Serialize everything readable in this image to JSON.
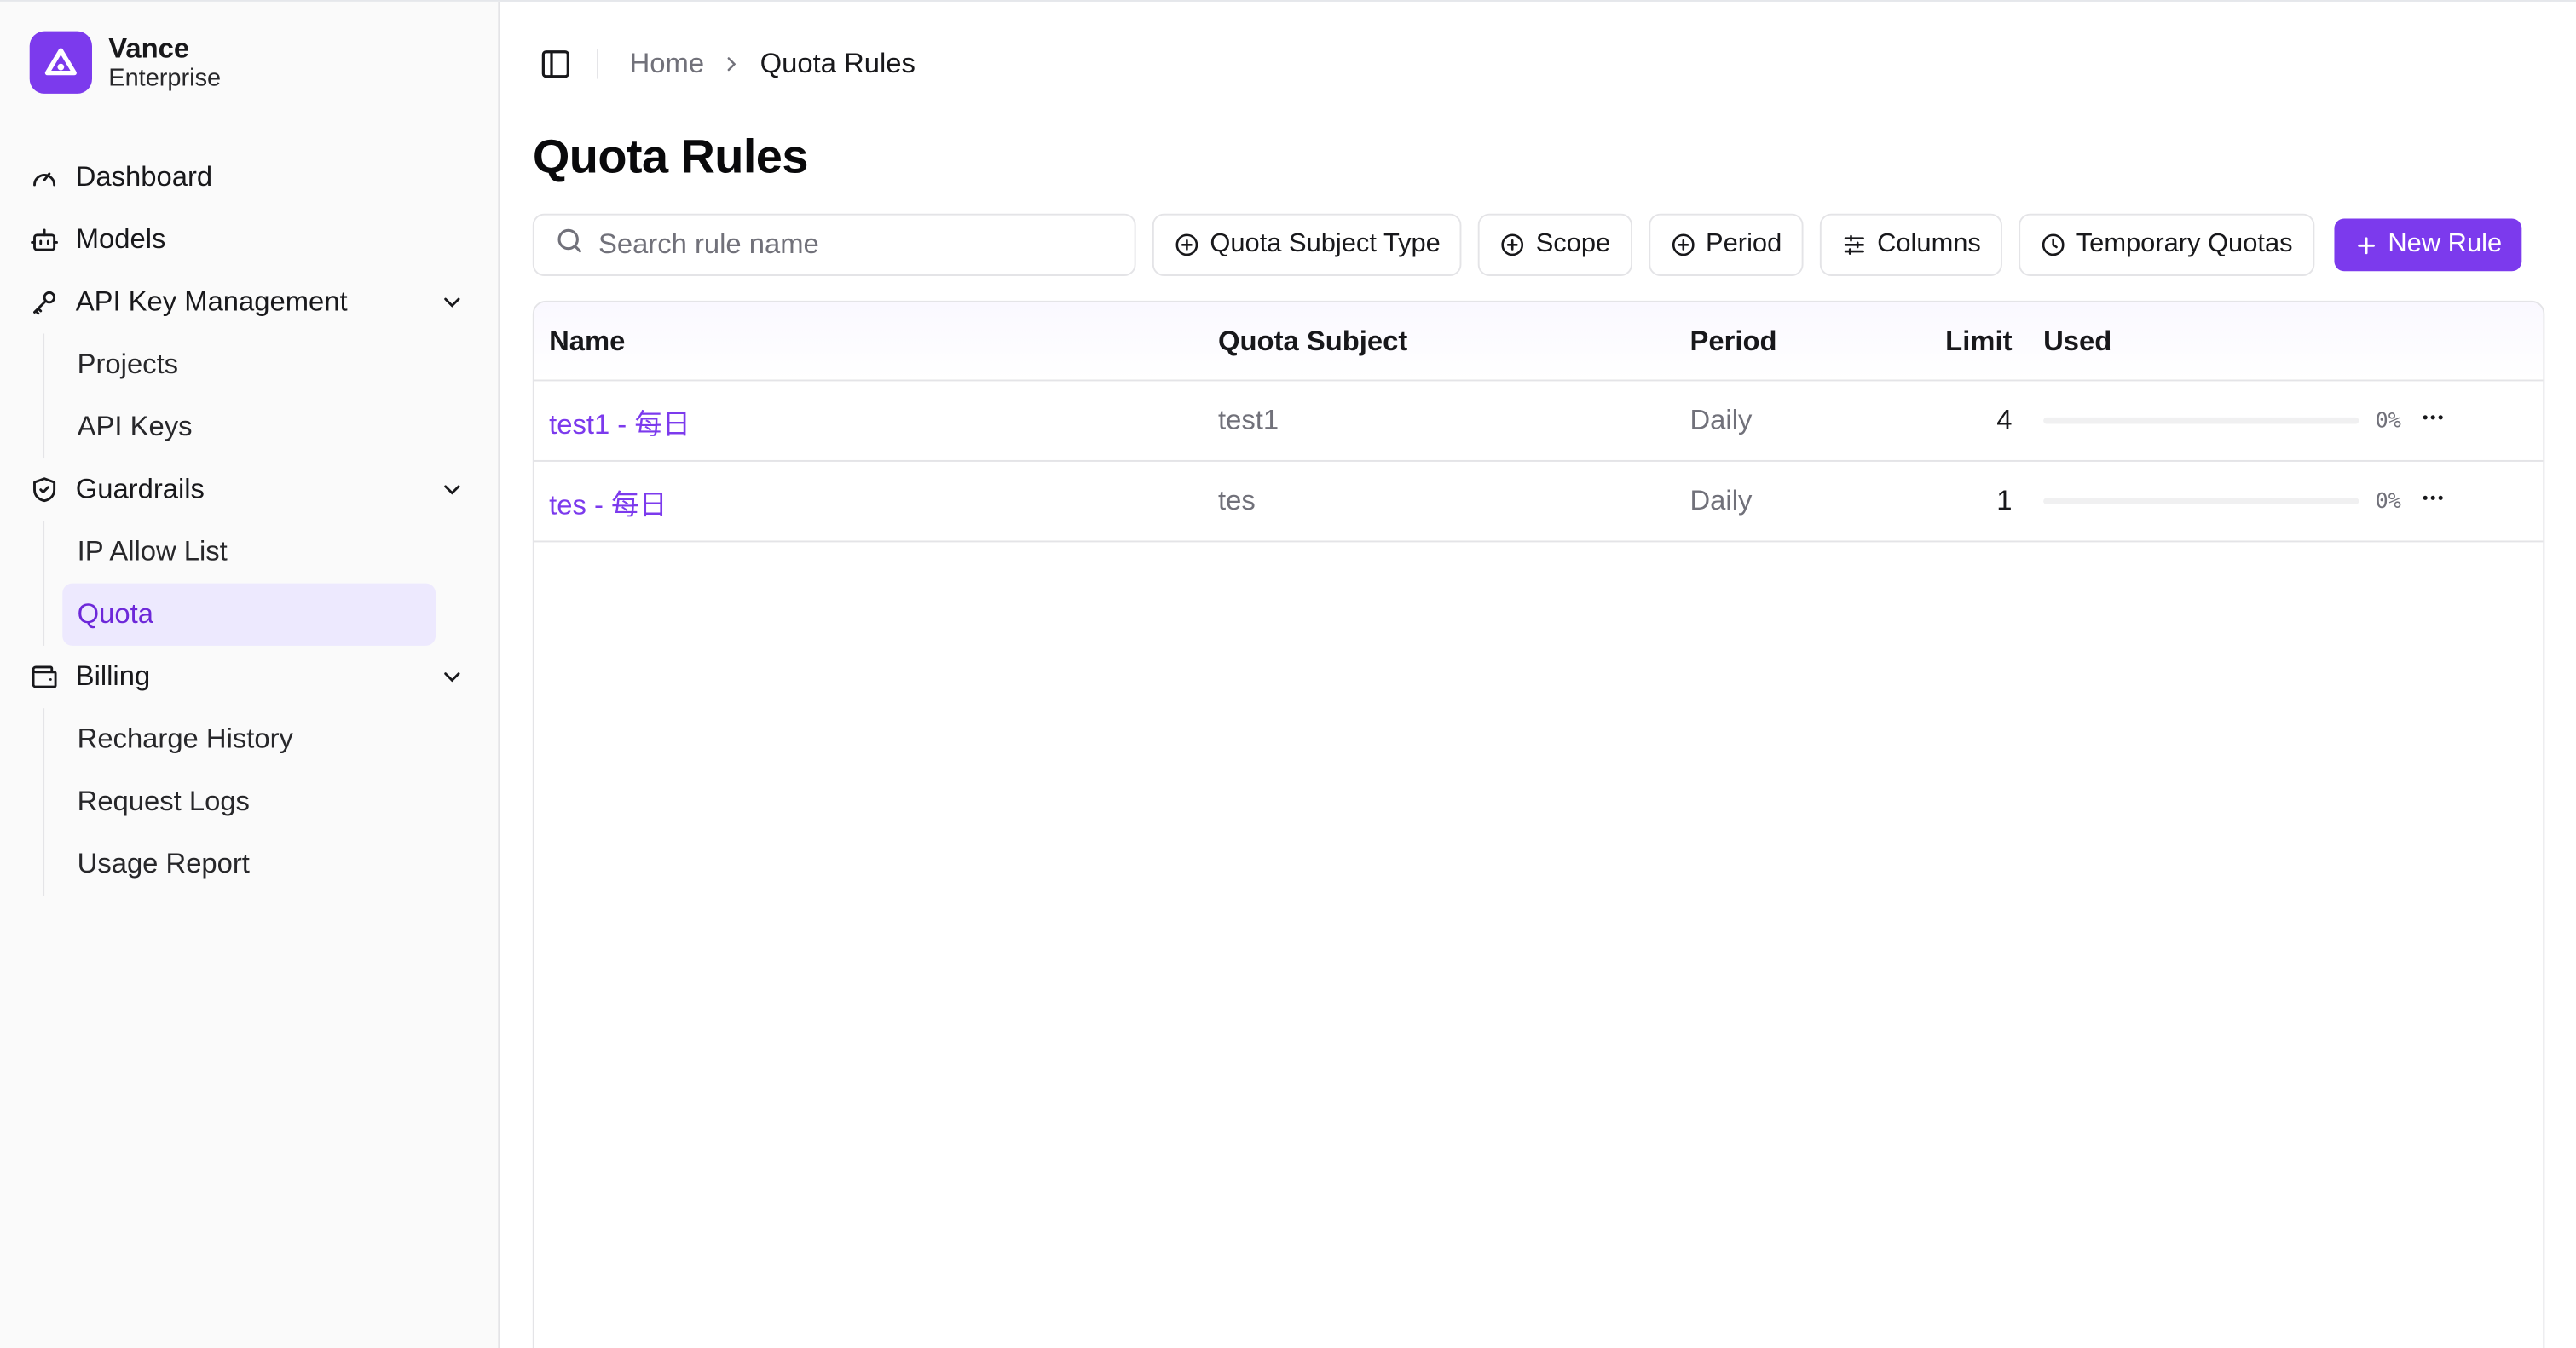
{
  "brand": {
    "name": "Vance",
    "subtitle": "Enterprise"
  },
  "sidebar": {
    "items": [
      {
        "label": "Dashboard",
        "icon": "gauge-icon"
      },
      {
        "label": "Models",
        "icon": "robot-icon"
      },
      {
        "label": "API Key Management",
        "icon": "key-icon",
        "expanded": true,
        "children": [
          {
            "label": "Projects"
          },
          {
            "label": "API Keys"
          }
        ]
      },
      {
        "label": "Guardrails",
        "icon": "shield-check-icon",
        "expanded": true,
        "children": [
          {
            "label": "IP Allow List"
          },
          {
            "label": "Quota",
            "active": true
          }
        ]
      },
      {
        "label": "Billing",
        "icon": "wallet-icon",
        "expanded": true,
        "children": [
          {
            "label": "Recharge History"
          },
          {
            "label": "Request Logs"
          },
          {
            "label": "Usage Report"
          }
        ]
      }
    ]
  },
  "breadcrumb": {
    "home": "Home",
    "current": "Quota Rules"
  },
  "page": {
    "title": "Quota Rules"
  },
  "toolbar": {
    "search_placeholder": "Search rule name",
    "filter_subject": "Quota Subject Type",
    "filter_scope": "Scope",
    "filter_period": "Period",
    "columns": "Columns",
    "temporary": "Temporary Quotas",
    "new_rule": "New Rule"
  },
  "table": {
    "headers": {
      "name": "Name",
      "subject": "Quota Subject",
      "period": "Period",
      "limit": "Limit",
      "used": "Used"
    },
    "rows": [
      {
        "name": "test1 - 每日",
        "subject": "test1",
        "period": "Daily",
        "limit": "4",
        "used_pct": "0%",
        "used_fraction": 0
      },
      {
        "name": "tes - 每日",
        "subject": "tes",
        "period": "Daily",
        "limit": "1",
        "used_pct": "0%",
        "used_fraction": 0
      }
    ]
  },
  "colors": {
    "accent": "#7c3aed",
    "active_bg": "#ede9fe",
    "border": "#e4e4e7"
  }
}
